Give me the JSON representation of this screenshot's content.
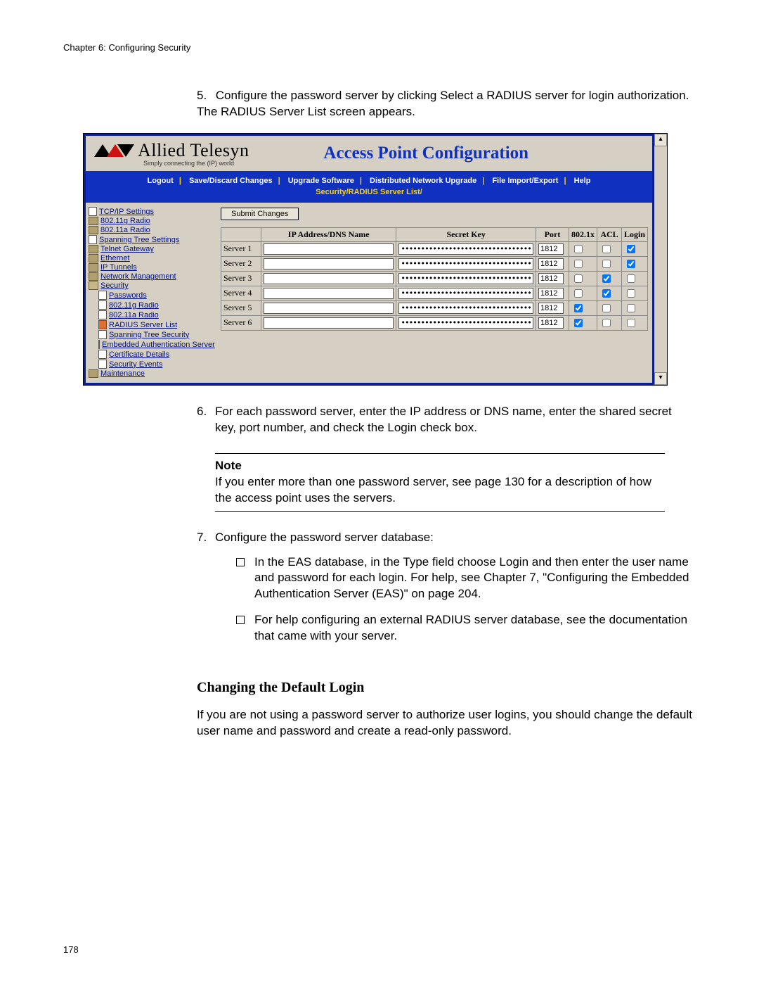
{
  "chapter_header": "Chapter 6: Configuring Security",
  "page_number": "178",
  "step5": {
    "num": "5.",
    "text": "Configure the password server by clicking Select a RADIUS server for login authorization. The RADIUS Server List screen appears."
  },
  "screenshot": {
    "brand": "Allied Telesyn",
    "tagline": "Simply connecting the (IP) world",
    "title": "Access Point Configuration",
    "menu": [
      "Logout",
      "Save/Discard Changes",
      "Upgrade Software",
      "Distributed Network Upgrade",
      "File Import/Export",
      "Help"
    ],
    "breadcrumb": "Security/RADIUS Server List/",
    "nav": [
      {
        "type": "doc",
        "label": "TCP/IP Settings",
        "sub": false
      },
      {
        "type": "folder",
        "label": "802.11g Radio",
        "sub": false
      },
      {
        "type": "folder",
        "label": "802.11a Radio",
        "sub": false
      },
      {
        "type": "doc",
        "label": "Spanning Tree Settings",
        "sub": false
      },
      {
        "type": "folder",
        "label": "Telnet Gateway",
        "sub": false
      },
      {
        "type": "folder",
        "label": "Ethernet",
        "sub": false
      },
      {
        "type": "folder",
        "label": "IP Tunnels",
        "sub": false
      },
      {
        "type": "folder",
        "label": "Network Management",
        "sub": false
      },
      {
        "type": "folder-open",
        "label": "Security",
        "sub": false
      },
      {
        "type": "doc",
        "label": "Passwords",
        "sub": true
      },
      {
        "type": "doc",
        "label": "802.11g Radio",
        "sub": true
      },
      {
        "type": "doc",
        "label": "802.11a Radio",
        "sub": true
      },
      {
        "type": "doc-orange",
        "label": "RADIUS Server List",
        "sub": true
      },
      {
        "type": "doc",
        "label": "Spanning Tree Security",
        "sub": true
      },
      {
        "type": "doc",
        "label": "Embedded Authentication Server",
        "sub": true
      },
      {
        "type": "doc",
        "label": "Certificate Details",
        "sub": true
      },
      {
        "type": "doc",
        "label": "Security Events",
        "sub": true
      },
      {
        "type": "folder",
        "label": "Maintenance",
        "sub": false
      }
    ],
    "submit_label": "Submit Changes",
    "table": {
      "headers": [
        "",
        "IP Address/DNS Name",
        "Secret Key",
        "Port",
        "802.1x",
        "ACL",
        "Login"
      ],
      "rows": [
        {
          "label": "Server 1",
          "ip": "",
          "secret": "****************************************",
          "port": "1812",
          "x": false,
          "acl": false,
          "login": true
        },
        {
          "label": "Server 2",
          "ip": "",
          "secret": "****************************************",
          "port": "1812",
          "x": false,
          "acl": false,
          "login": true
        },
        {
          "label": "Server 3",
          "ip": "",
          "secret": "****************************************",
          "port": "1812",
          "x": false,
          "acl": true,
          "login": false
        },
        {
          "label": "Server 4",
          "ip": "",
          "secret": "****************************************",
          "port": "1812",
          "x": false,
          "acl": true,
          "login": false
        },
        {
          "label": "Server 5",
          "ip": "",
          "secret": "****************************************",
          "port": "1812",
          "x": true,
          "acl": false,
          "login": false
        },
        {
          "label": "Server 6",
          "ip": "",
          "secret": "****************************************",
          "port": "1812",
          "x": true,
          "acl": false,
          "login": false
        }
      ]
    }
  },
  "step6": {
    "num": "6.",
    "text": "For each password server, enter the IP address or DNS name, enter the shared secret key, port number, and check the Login check box."
  },
  "note": {
    "title": "Note",
    "text": "If you enter more than one password server, see page 130 for a description of how the access point uses the servers."
  },
  "step7": {
    "num": "7.",
    "text": "Configure the password server database:",
    "bullets": [
      "In the EAS database, in the Type field choose Login and then enter the user name and password for each login. For help, see Chapter 7,  \"Configuring the Embedded Authentication Server (EAS)\" on page 204.",
      "For help configuring an external RADIUS server database, see the documentation that came with your server."
    ]
  },
  "sub_heading": "Changing the Default Login",
  "para": "If you are not using a password server to authorize user logins, you should change the default user name and password and create a read-only password."
}
